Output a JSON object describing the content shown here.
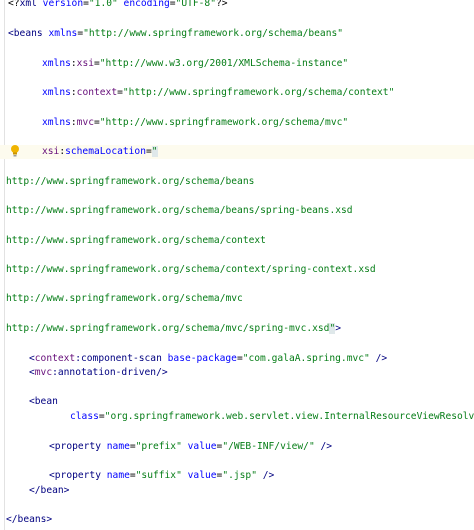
{
  "editor": {
    "lines": [
      [
        [
          "tk-pi",
          "<?"
        ],
        [
          "tk-tag",
          "xml "
        ],
        [
          "tk-attr",
          "version"
        ],
        [
          "tk-plain",
          "="
        ],
        [
          "tk-val",
          "\"1.0\" "
        ],
        [
          "tk-attr",
          "encoding"
        ],
        [
          "tk-plain",
          "="
        ],
        [
          "tk-val",
          "\"UTF-8\""
        ],
        [
          "tk-pi",
          "?>"
        ]
      ],
      [
        [
          "tk-tag",
          "<beans "
        ],
        [
          "tk-attr",
          "xmlns"
        ],
        [
          "tk-plain",
          "="
        ],
        [
          "tk-val",
          "\"http://www.springframework.org/schema/beans\""
        ]
      ],
      [
        [
          "tk-attr",
          "xmlns"
        ],
        [
          "tk-plain",
          ":"
        ],
        [
          "tk-ns",
          "xsi"
        ],
        [
          "tk-plain",
          "="
        ],
        [
          "tk-val",
          "\"http://www.w3.org/2001/XMLSchema-instance\""
        ]
      ],
      [
        [
          "tk-attr",
          "xmlns"
        ],
        [
          "tk-plain",
          ":"
        ],
        [
          "tk-ns",
          "context"
        ],
        [
          "tk-plain",
          "="
        ],
        [
          "tk-val",
          "\"http://www.springframework.org/schema/context\""
        ]
      ],
      [
        [
          "tk-attr",
          "xmlns"
        ],
        [
          "tk-plain",
          ":"
        ],
        [
          "tk-ns",
          "mvc"
        ],
        [
          "tk-plain",
          "="
        ],
        [
          "tk-val",
          "\"http://www.springframework.org/schema/mvc\""
        ]
      ],
      [
        [
          "tk-ns",
          "xsi"
        ],
        [
          "tk-plain",
          ":"
        ],
        [
          "tk-attr",
          "schemaLocation"
        ],
        [
          "tk-plain",
          "="
        ],
        [
          "tk-val tk-match",
          "\""
        ]
      ],
      [
        [
          "tk-val",
          "http://www.springframework.org/schema/beans"
        ]
      ],
      [
        [
          "tk-val",
          "http://www.springframework.org/schema/beans/spring-beans.xsd"
        ]
      ],
      [
        [
          "tk-val",
          "http://www.springframework.org/schema/context"
        ]
      ],
      [
        [
          "tk-val",
          "http://www.springframework.org/schema/context/spring-context.xsd"
        ]
      ],
      [
        [
          "tk-val",
          "http://www.springframework.org/schema/mvc"
        ]
      ],
      [
        [
          "tk-val",
          "http://www.springframework.org/schema/mvc/spring-mvc.xsd"
        ],
        [
          "tk-val tk-match",
          "\""
        ],
        [
          "tk-tag",
          ">"
        ]
      ],
      [
        [
          "tk-tag",
          "<"
        ],
        [
          "tk-ns",
          "context"
        ],
        [
          "tk-tag",
          ":component-scan "
        ],
        [
          "tk-attr",
          "base-package"
        ],
        [
          "tk-plain",
          "="
        ],
        [
          "tk-val",
          "\"com.galaA.spring.mvc\""
        ],
        [
          "tk-tag",
          " />"
        ]
      ],
      [
        [
          "tk-tag",
          "<"
        ],
        [
          "tk-ns",
          "mvc"
        ],
        [
          "tk-tag",
          ":annotation-driven/>"
        ]
      ],
      [
        [
          "tk-tag",
          "<bean"
        ]
      ],
      [
        [
          "tk-attr",
          "class"
        ],
        [
          "tk-plain",
          "="
        ],
        [
          "tk-val",
          "\"org.springframework.web.servlet.view.InternalResourceViewResolver\""
        ],
        [
          "tk-tag",
          ">"
        ]
      ],
      [
        [
          "tk-tag",
          "<property "
        ],
        [
          "tk-attr",
          "name"
        ],
        [
          "tk-plain",
          "="
        ],
        [
          "tk-val",
          "\"prefix\" "
        ],
        [
          "tk-attr",
          "value"
        ],
        [
          "tk-plain",
          "="
        ],
        [
          "tk-val",
          "\"/WEB-INF/view/\""
        ],
        [
          "tk-tag",
          " />"
        ]
      ],
      [
        [
          "tk-tag",
          "<property "
        ],
        [
          "tk-attr",
          "name"
        ],
        [
          "tk-plain",
          "="
        ],
        [
          "tk-val",
          "\"suffix\" "
        ],
        [
          "tk-attr",
          "value"
        ],
        [
          "tk-plain",
          "="
        ],
        [
          "tk-val",
          "\".jsp\""
        ],
        [
          "tk-tag",
          " />"
        ]
      ],
      [
        [
          "tk-tag",
          "</bean>"
        ]
      ],
      [
        [
          "tk-tag",
          "</beans>"
        ]
      ]
    ]
  },
  "icons": {
    "intention": "lightbulb-icon"
  },
  "colors": {
    "tag": "#000080",
    "attribute": "#0000ff",
    "namespace": "#660e7a",
    "value": "#067d17",
    "current_line": "#fdfbee"
  }
}
